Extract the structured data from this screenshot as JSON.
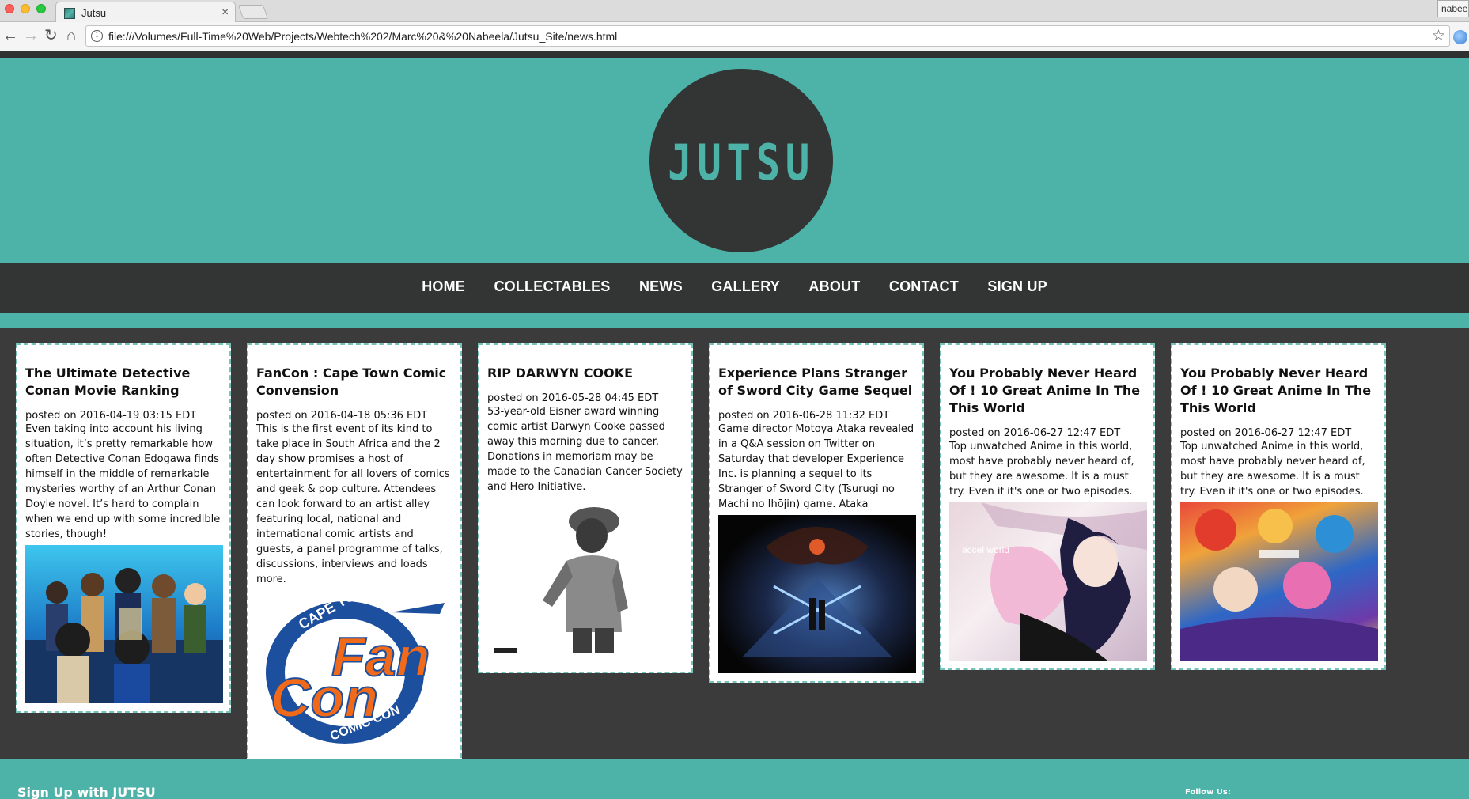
{
  "browser": {
    "tab_title": "Jutsu",
    "tab_close": "×",
    "profile_name": "nabee",
    "url": "file:///Volumes/Full-Time%20Web/Projects/Webtech%202/Marc%20&%20Nabeela/Jutsu_Site/news.html",
    "back": "←",
    "forward": "→",
    "reload": "↻",
    "home": "⌂",
    "star": "☆",
    "info": "i"
  },
  "site": {
    "logo_text": "JUTSU",
    "colors": {
      "teal": "#4db3a8",
      "dark": "#333534",
      "body": "#3a3b3a"
    }
  },
  "nav": {
    "items": [
      {
        "label": "HOME"
      },
      {
        "label": "COLLECTABLES"
      },
      {
        "label": "NEWS"
      },
      {
        "label": "GALLERY"
      },
      {
        "label": "ABOUT"
      },
      {
        "label": "CONTACT"
      },
      {
        "label": "SIGN UP"
      }
    ]
  },
  "news": [
    {
      "title": "The Ultimate Detective Conan Movie Ranking",
      "posted": "posted on 2016-04-19 03:15 EDT",
      "body": "Even taking into account his living situation, it’s pretty remarkable how often Detective Conan Edogawa finds himself in the middle of remarkable mysteries worthy of an Arthur Conan Doyle novel. It’s hard to complain when we end up with some incredible stories, though!",
      "image": "detective-conan-poster"
    },
    {
      "title": "FanCon : Cape Town Comic Convension",
      "posted": "posted on 2016-04-18 05:36 EDT",
      "body": "This is the first event of its kind to take place in South Africa and the 2 day show promises a host of entertainment for all lovers of comics and geek & pop culture. Attendees can look forward to an artist alley featuring local, national and international comic artists and guests, a panel programme of talks, discussions, interviews and loads more.",
      "image": "fancon-logo",
      "logo_top": "CAPE TOWN",
      "logo_main_1": "Fan",
      "logo_main_2": "Con",
      "logo_bottom": "COMIC CON"
    },
    {
      "title": "RIP DARWYN COOKE",
      "posted": "posted on 2016-05-28 04:45 EDT",
      "body": "53-year-old Eisner award winning comic artist Darwyn Cooke passed away this morning due to cancer. Donations in memoriam may be made to the Canadian Cancer Society and Hero Initiative.",
      "image": "darwyn-cooke-portrait"
    },
    {
      "title": "Experience Plans Stranger of Sword City Game Sequel",
      "posted": "posted on 2016-06-28 11:32 EDT",
      "body": "Game director Motoya Ataka revealed in a Q&A session on Twitter on Saturday that developer Experience Inc. is planning a sequel to its Stranger of Sword City (Tsurugi no Machi no Ihōjin) game. Ataka",
      "image": "stranger-of-sword-city-art"
    },
    {
      "title": "You Probably Never Heard Of ! 10 Great Anime In The This World",
      "posted": "posted on 2016-06-27 12:47 EDT",
      "body": "Top unwatched Anime in this world, most have probably never heard of, but they are awesome. It is a must try. Even if it's one or two episodes.",
      "image": "accel-world-art",
      "caption": "accel world"
    },
    {
      "title": "You Probably Never Heard Of ! 10 Great Anime In The This World",
      "posted": "posted on 2016-06-27 12:47 EDT",
      "body": "Top unwatched Anime in this world, most have probably never heard of, but they are awesome. It is a must try. Even if it's one or two episodes.",
      "image": "anime-collage-art"
    }
  ],
  "footer": {
    "signup_title": "Sign Up with JUTSU",
    "follow_label": "Follow Us:"
  }
}
